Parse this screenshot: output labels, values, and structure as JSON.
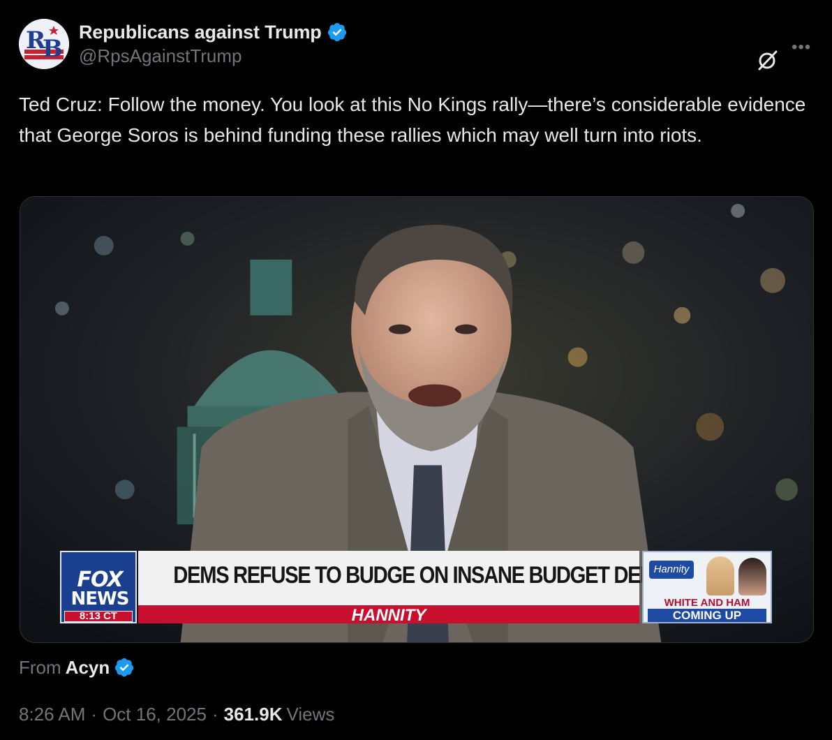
{
  "author": {
    "display_name": "Republicans against Trump",
    "handle": "@RpsAgainstTrump",
    "avatar_letters": "RB",
    "verified_color": "#1d9bf0"
  },
  "tweet": {
    "text": "Ted Cruz: Follow the money. You look at this No Kings rally—there’s considerable evidence that George Soros is behind funding these rallies which may well turn into riots."
  },
  "media": {
    "network_logo_top": "FOX",
    "network_logo_bottom": "NEWS",
    "time": "8:13 CT",
    "headline": "DEMS REFUSE TO BUDGE ON INSANE BUDGET DEMANDS",
    "show": "HANNITY",
    "promo_logo": "Hannity",
    "promo_line1": "WHITE AND HAM",
    "promo_line2": "COMING UP"
  },
  "source": {
    "label": "From",
    "name": "Acyn"
  },
  "meta": {
    "time": "8:26 AM",
    "separator": "·",
    "date": "Oct 16, 2025",
    "views_count": "361.9K",
    "views_label": "Views"
  },
  "icons": {
    "grok": "grok-icon",
    "more": "more-icon",
    "verified": "verified-badge-icon"
  },
  "colors": {
    "background": "#000000",
    "text": "#e7e9ea",
    "muted": "#71767b",
    "fox_red": "#c8102e",
    "fox_blue": "#1b3f8f"
  }
}
